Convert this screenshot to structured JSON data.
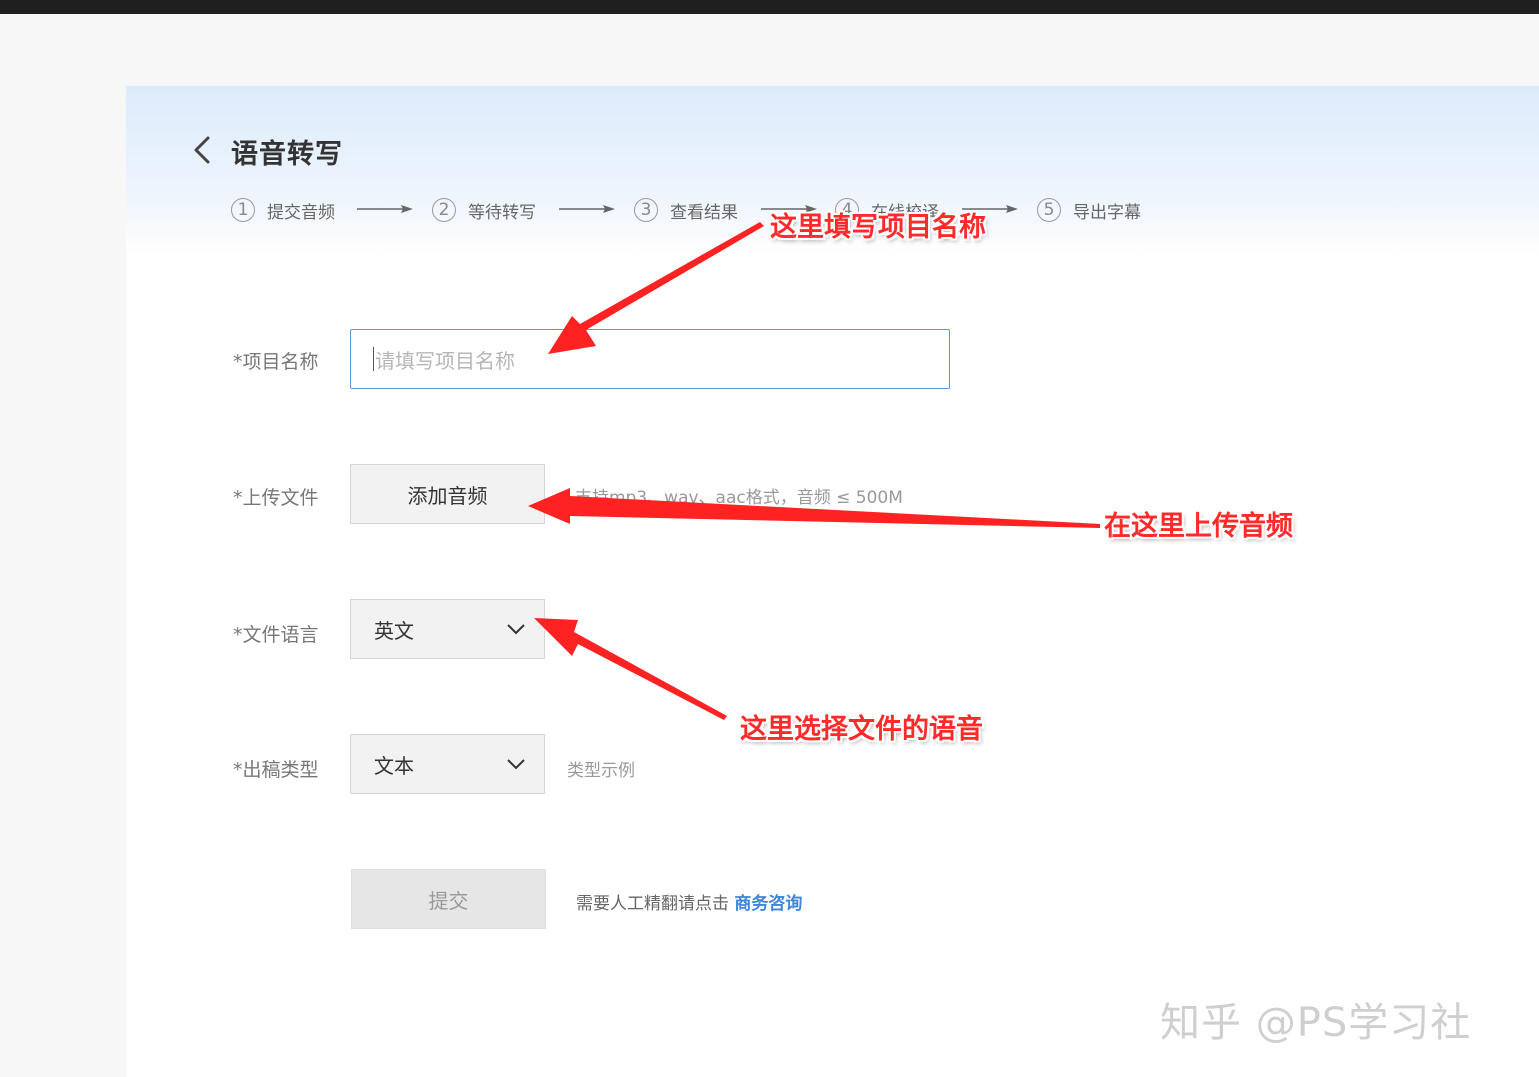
{
  "header": {
    "title": "语音转写"
  },
  "steps": [
    {
      "num": "1",
      "label": "提交音频"
    },
    {
      "num": "2",
      "label": "等待转写"
    },
    {
      "num": "3",
      "label": "查看结果"
    },
    {
      "num": "4",
      "label": "在线校译"
    },
    {
      "num": "5",
      "label": "导出字幕"
    }
  ],
  "form": {
    "project_name": {
      "label": "*项目名称",
      "placeholder": "请填写项目名称",
      "value": ""
    },
    "upload": {
      "label": "*上传文件",
      "button_label": "添加音频",
      "hint": "支持mp3、wav、aac格式，音频 ≤ 500M"
    },
    "language": {
      "label": "*文件语言",
      "selected": "英文"
    },
    "output_type": {
      "label": "*出稿类型",
      "selected": "文本",
      "hint": "类型示例"
    },
    "submit": {
      "button_label": "提交",
      "consult_text": "需要人工精翻请点击",
      "consult_link": "商务咨询"
    }
  },
  "annotations": [
    {
      "text": "这里填写项目名称"
    },
    {
      "text": "在这里上传音频"
    },
    {
      "text": "这里选择文件的语音"
    }
  ],
  "watermark": "知乎 @PS学习社",
  "colors": {
    "accent": "#3d86d9",
    "input_border": "#5a98d6",
    "annotation": "#ff2b2b",
    "topbar": "#1f1f1f"
  }
}
